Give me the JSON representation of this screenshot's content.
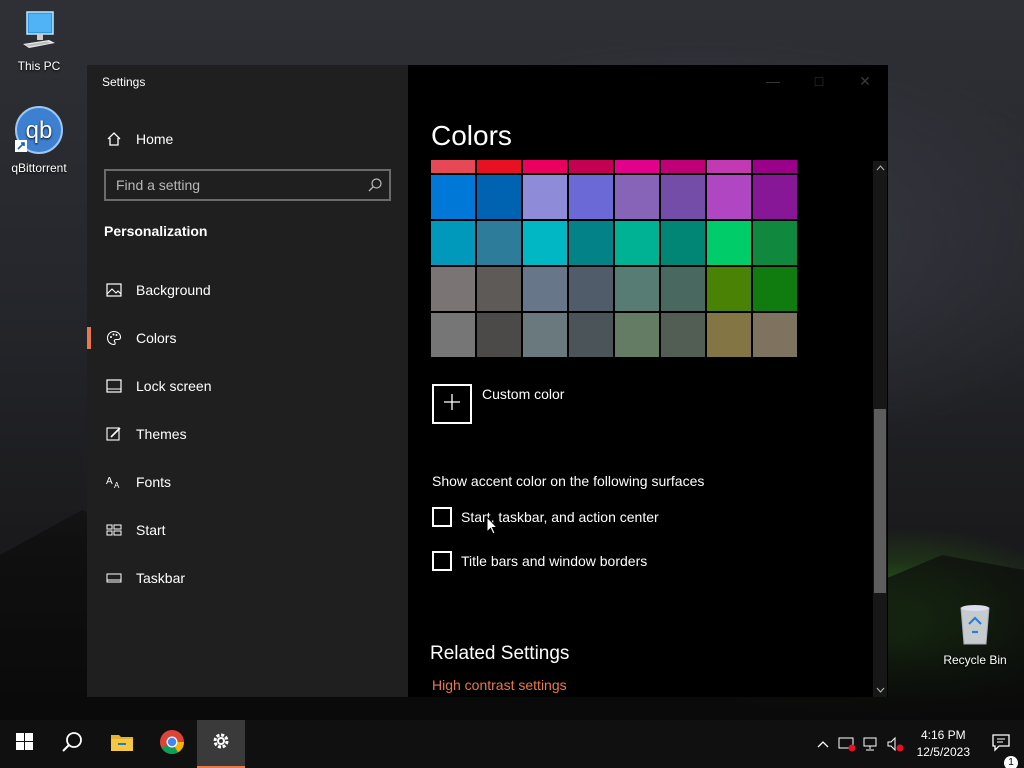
{
  "desktop": {
    "icons": [
      {
        "label": "This PC"
      },
      {
        "label": "qBittorrent"
      },
      {
        "label": "Recycle Bin"
      }
    ]
  },
  "window": {
    "title": "Settings",
    "sidebar": {
      "home_label": "Home",
      "search_placeholder": "Find a setting",
      "section_title": "Personalization",
      "items": [
        {
          "label": "Background",
          "icon": "picture-icon"
        },
        {
          "label": "Colors",
          "icon": "palette-icon",
          "active": true
        },
        {
          "label": "Lock screen",
          "icon": "lock-screen-icon"
        },
        {
          "label": "Themes",
          "icon": "themes-icon"
        },
        {
          "label": "Fonts",
          "icon": "fonts-icon"
        },
        {
          "label": "Start",
          "icon": "start-icon"
        },
        {
          "label": "Taskbar",
          "icon": "taskbar-icon"
        }
      ]
    },
    "content": {
      "title": "Colors",
      "swatch_rows": [
        [
          "#e74856",
          "#e81123",
          "#ea005e",
          "#c30052",
          "#e3008c",
          "#bf0077",
          "#c239b3",
          "#9a0089"
        ],
        [
          "#0078d7",
          "#0063b1",
          "#8e8cd8",
          "#6b69d6",
          "#8764b8",
          "#744da9",
          "#b146c2",
          "#881798"
        ],
        [
          "#0099bc",
          "#2d7d9a",
          "#00b7c3",
          "#038387",
          "#00b294",
          "#018574",
          "#00cc6a",
          "#10893e"
        ],
        [
          "#7a7574",
          "#5d5a58",
          "#68768a",
          "#515c6b",
          "#567c73",
          "#486860",
          "#498205",
          "#107c10"
        ],
        [
          "#767676",
          "#4c4a48",
          "#69797e",
          "#4a5459",
          "#647c64",
          "#525e54",
          "#847545",
          "#7e735f"
        ]
      ],
      "custom_color_label": "Custom color",
      "accent_heading": "Show accent color on the following surfaces",
      "checkboxes": [
        {
          "label": "Start, taskbar, and action center",
          "checked": false
        },
        {
          "label": "Title bars and window borders",
          "checked": false
        }
      ],
      "related_title": "Related Settings",
      "related_link": "High contrast settings"
    }
  },
  "taskbar": {
    "time": "4:16 PM",
    "date": "12/5/2023",
    "notification_count": "1",
    "accent": "#e8794a"
  }
}
